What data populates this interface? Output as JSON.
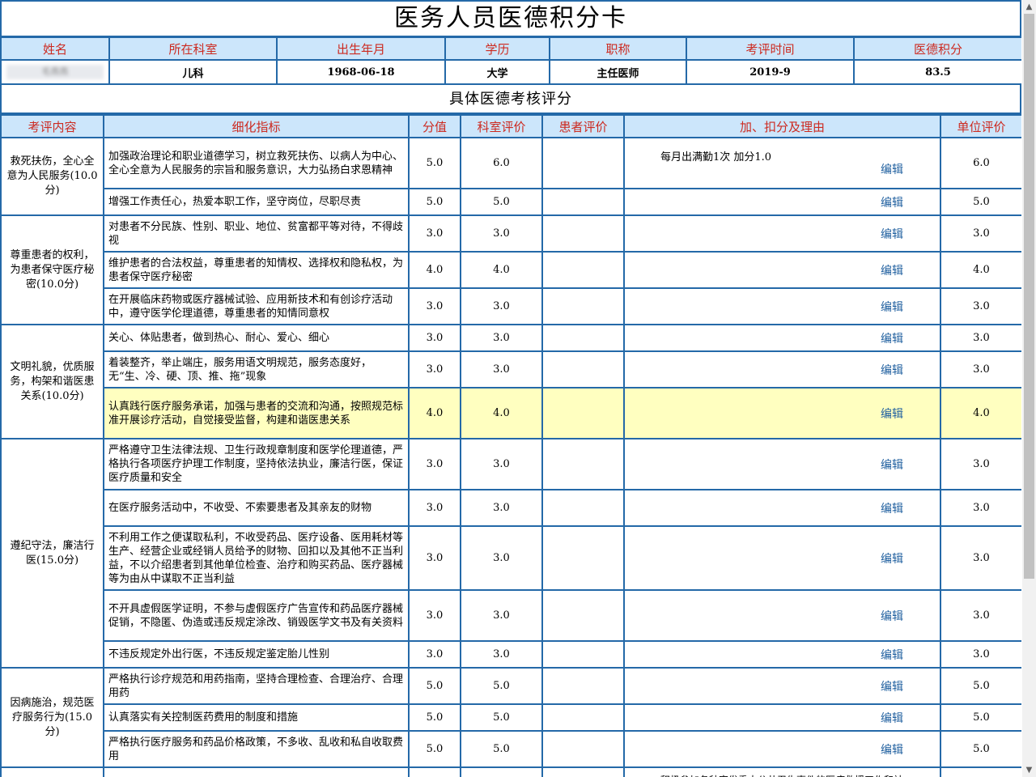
{
  "title": "医务人员医德积分卡",
  "info": {
    "headers": [
      "姓名",
      "所在科室",
      "出生年月",
      "学历",
      "职称",
      "考评时间",
      "医德积分"
    ],
    "name": "毛燕燕",
    "department": "儿科",
    "birth": "1968-06-18",
    "education": "大学",
    "title": "主任医师",
    "eval_time": "2019-9",
    "score": "83.5"
  },
  "subtitle": "具体医德考核评分",
  "table": {
    "headers": [
      "考评内容",
      "细化指标",
      "分值",
      "科室评价",
      "患者评价",
      "加、扣分及理由",
      "单位评价"
    ],
    "edit_label": "编辑",
    "categories": [
      {
        "name": "救死扶伤，全心全意为人民服务(10.0分)",
        "rows": [
          {
            "indicator": "加强政治理论和职业道德学习，树立救死扶伤、以病人为中心、全心全意为人民服务的宗旨和服务意识，大力弘扬白求恩精神",
            "score": "5.0",
            "dept": "6.0",
            "patient": "",
            "reason": "每月出满勤1次  加分1.0",
            "unit": "6.0"
          },
          {
            "indicator": "增强工作责任心，热爱本职工作，坚守岗位，尽职尽责",
            "score": "5.0",
            "dept": "5.0",
            "patient": "",
            "reason": "",
            "unit": "5.0"
          }
        ]
      },
      {
        "name": "尊重患者的权利，为患者保守医疗秘密(10.0分)",
        "rows": [
          {
            "indicator": "对患者不分民族、性别、职业、地位、贫富都平等对待，不得歧视",
            "score": "3.0",
            "dept": "3.0",
            "patient": "",
            "reason": "",
            "unit": "3.0"
          },
          {
            "indicator": "维护患者的合法权益，尊重患者的知情权、选择权和隐私权，为患者保守医疗秘密",
            "score": "4.0",
            "dept": "4.0",
            "patient": "",
            "reason": "",
            "unit": "4.0"
          },
          {
            "indicator": "在开展临床药物或医疗器械试验、应用新技术和有创诊疗活动中，遵守医学伦理道德，尊重患者的知情同意权",
            "score": "3.0",
            "dept": "3.0",
            "patient": "",
            "reason": "",
            "unit": "3.0"
          }
        ]
      },
      {
        "name": "文明礼貌，优质服务，构架和谐医患关系(10.0分)",
        "rows": [
          {
            "indicator": "关心、体贴患者，做到热心、耐心、爱心、细心",
            "score": "3.0",
            "dept": "3.0",
            "patient": "",
            "reason": "",
            "unit": "3.0"
          },
          {
            "indicator": "着装整齐，举止端庄，服务用语文明规范，服务态度好，无“生、冷、硬、顶、推、拖”现象",
            "score": "3.0",
            "dept": "3.0",
            "patient": "",
            "reason": "",
            "unit": "3.0"
          },
          {
            "indicator": "认真践行医疗服务承诺，加强与患者的交流和沟通，按照规范标准开展诊疗活动，自觉接受监督，构建和谐医患关系",
            "score": "4.0",
            "dept": "4.0",
            "patient": "",
            "reason": "",
            "unit": "4.0"
          }
        ]
      },
      {
        "name": "遵纪守法，廉洁行医(15.0分)",
        "rows": [
          {
            "indicator": "严格遵守卫生法律法规、卫生行政规章制度和医学伦理道德，严格执行各项医疗护理工作制度，坚持依法执业，廉洁行医，保证医疗质量和安全",
            "score": "3.0",
            "dept": "3.0",
            "patient": "",
            "reason": "",
            "unit": "3.0"
          },
          {
            "indicator": "在医疗服务活动中，不收受、不索要患者及其亲友的财物",
            "score": "3.0",
            "dept": "3.0",
            "patient": "",
            "reason": "",
            "unit": "3.0"
          },
          {
            "indicator": "不利用工作之便谋取私利，不收受药品、医疗设备、医用耗材等生产、经营企业或经销人员给予的财物、回扣以及其他不正当利益，不以介绍患者到其他单位检查、治疗和购买药品、医疗器械等为由从中谋取不正当利益",
            "score": "3.0",
            "dept": "3.0",
            "patient": "",
            "reason": "",
            "unit": "3.0"
          },
          {
            "indicator": "不开具虚假医学证明，不参与虚假医疗广告宣传和药品医疗器械促销，不隐匿、伪造或违反规定涂改、销毁医学文书及有关资料",
            "score": "3.0",
            "dept": "3.0",
            "patient": "",
            "reason": "",
            "unit": "3.0"
          },
          {
            "indicator": "不违反规定外出行医，不违反规定鉴定胎儿性别",
            "score": "3.0",
            "dept": "3.0",
            "patient": "",
            "reason": "",
            "unit": "3.0"
          }
        ]
      },
      {
        "name": "因病施治，规范医疗服务行为(15.0分)",
        "rows": [
          {
            "indicator": "严格执行诊疗规范和用药指南，坚持合理检查、合理治疗、合理用药",
            "score": "5.0",
            "dept": "5.0",
            "patient": "",
            "reason": "",
            "unit": "5.0"
          },
          {
            "indicator": "认真落实有关控制医药费用的制度和措施",
            "score": "5.0",
            "dept": "5.0",
            "patient": "",
            "reason": "",
            "unit": "5.0"
          },
          {
            "indicator": "严格执行医疗服务和药品价格政策，不多收、乱收和私自收取费用",
            "score": "5.0",
            "dept": "5.0",
            "patient": "",
            "reason": "",
            "unit": "5.0"
          }
        ]
      }
    ],
    "partial_reason": "积极参加各种突发重大公共卫生事件的医疗救援工作和社"
  }
}
